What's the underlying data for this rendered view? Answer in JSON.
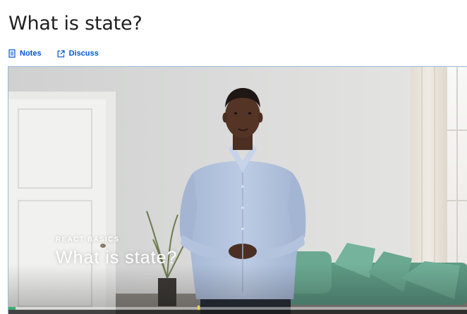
{
  "page": {
    "title": "What is state?"
  },
  "actions": {
    "notes_label": "Notes",
    "discuss_label": "Discuss"
  },
  "video": {
    "course_label": "REACT BASICS",
    "overlay_title": "What is state?",
    "progress_fraction": 0.015,
    "colors": {
      "progress": "#3fae6b",
      "link": "#0056d2"
    },
    "icons": [
      "notes-icon",
      "external-link-icon"
    ]
  }
}
